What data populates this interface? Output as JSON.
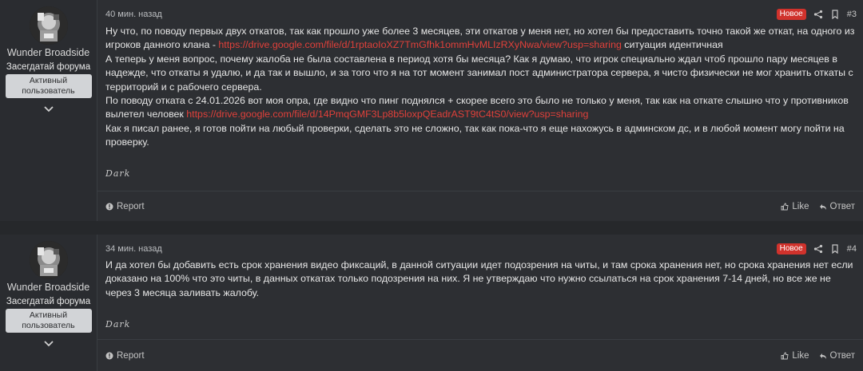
{
  "posts": [
    {
      "author": {
        "name": "Wunder Broadside",
        "title": "Засегдатай форума",
        "badge": "Активный пользователь"
      },
      "time": "40 мин. назад",
      "new_label": "Новое",
      "number": "#3",
      "message": {
        "l1_text": "Ну что, по поводу первых двух откатов, так как прошло уже более 3 месяцев, эти откатов у меня нет, но хотел бы предоставить точно такой же откат, на одного из игроков данного клана - ",
        "l1_link": "https://drive.google.com/file/d/1rptaoIoXZ7TmGfhk1ommHvMLIzRXyNwa/view?usp=sharing",
        "l1_tail": " ситуация идентичная",
        "l2": "А теперь у меня вопрос, почему жалоба не была составлена в период хотя бы месяца? Как я думаю, что игрок специально ждал чтоб прошло пару месяцев в надежде, что откаты я удалю, и да так и вышло, и за того что я на тот момент занимал пост администратора сервера, я чисто физически не мог хранить откаты с территорий и с рабочего сервера.",
        "l3_text": "По поводу отката с 24.01.2026 вот моя опра, где видно что пинг поднялся + скорее всего это было не только у меня, так как на откате слышно что у противников вылетел человек ",
        "l3_link": "https://drive.google.com/file/d/14PmqGMF3Lp8b5loxpQEadrAST9tC4tS0/view?usp=sharing",
        "l4": "Как я писал ранее, я готов пойти на любый проверки, сделать это не сложно, так как пока-что я еще нахожусь в админском дс, и в любой момент могу пойти на проверку."
      },
      "signature": "Dark",
      "report": "Report",
      "like": "Like",
      "reply": "Ответ"
    },
    {
      "author": {
        "name": "Wunder Broadside",
        "title": "Засегдатай форума",
        "badge": "Активный пользователь"
      },
      "time": "34 мин. назад",
      "new_label": "Новое",
      "number": "#4",
      "message": {
        "text": "И да хотел бы добавить есть срок хранения видео фиксаций, в данной ситуации идет подозрения на читы, и там срока хранения нет, но срока хранения нет если доказано на 100% что это читы, в данных откатах только подозрения на них. Я не утверждаю что нужно ссылаться на срок хранения 7-14 дней, но все же не через 3 месяца заливать жалобу."
      },
      "signature": "Dark",
      "report": "Report",
      "like": "Like",
      "reply": "Ответ"
    }
  ],
  "colors": {
    "accent_link": "#e0403a",
    "new_badge": "#d0322c",
    "page_bg": "#26282b",
    "post_bg": "#2d2f33"
  },
  "icons": [
    "avatar",
    "chevron-down-icon",
    "share-icon",
    "bookmark-icon",
    "report-icon",
    "like-icon",
    "reply-icon"
  ]
}
